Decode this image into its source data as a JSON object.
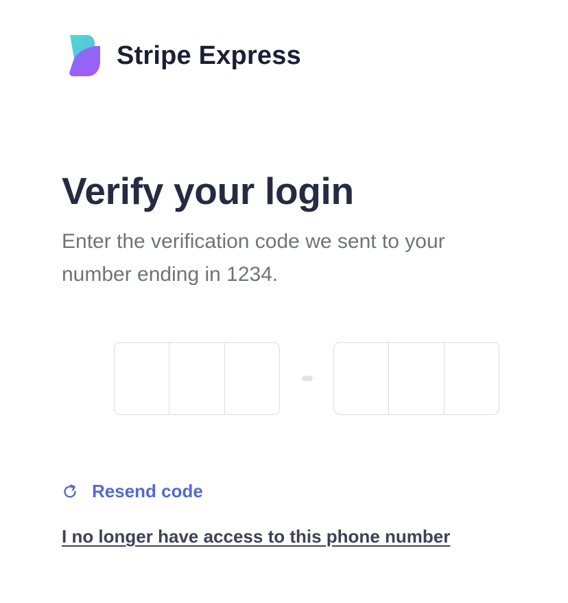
{
  "header": {
    "brand_name": "Stripe Express",
    "logo_icon": "stripe-express-logo"
  },
  "main": {
    "title": "Verify your login",
    "subtitle": "Enter the verification code we sent to your number ending in 1234."
  },
  "code_input": {
    "groups": [
      {
        "digits": [
          "",
          "",
          ""
        ]
      },
      {
        "digits": [
          "",
          "",
          ""
        ]
      }
    ],
    "separator_color": "#e2e3ee"
  },
  "actions": {
    "resend_label": "Resend code",
    "resend_icon": "refresh-icon",
    "no_access_label": "I no longer have access to this phone number"
  },
  "colors": {
    "link_blue": "#5469d4",
    "title": "#252b43",
    "subtitle": "#6f7377",
    "logo_gradient_top": "#5fe0d0",
    "logo_gradient_bottom": "#9b5cf6"
  }
}
